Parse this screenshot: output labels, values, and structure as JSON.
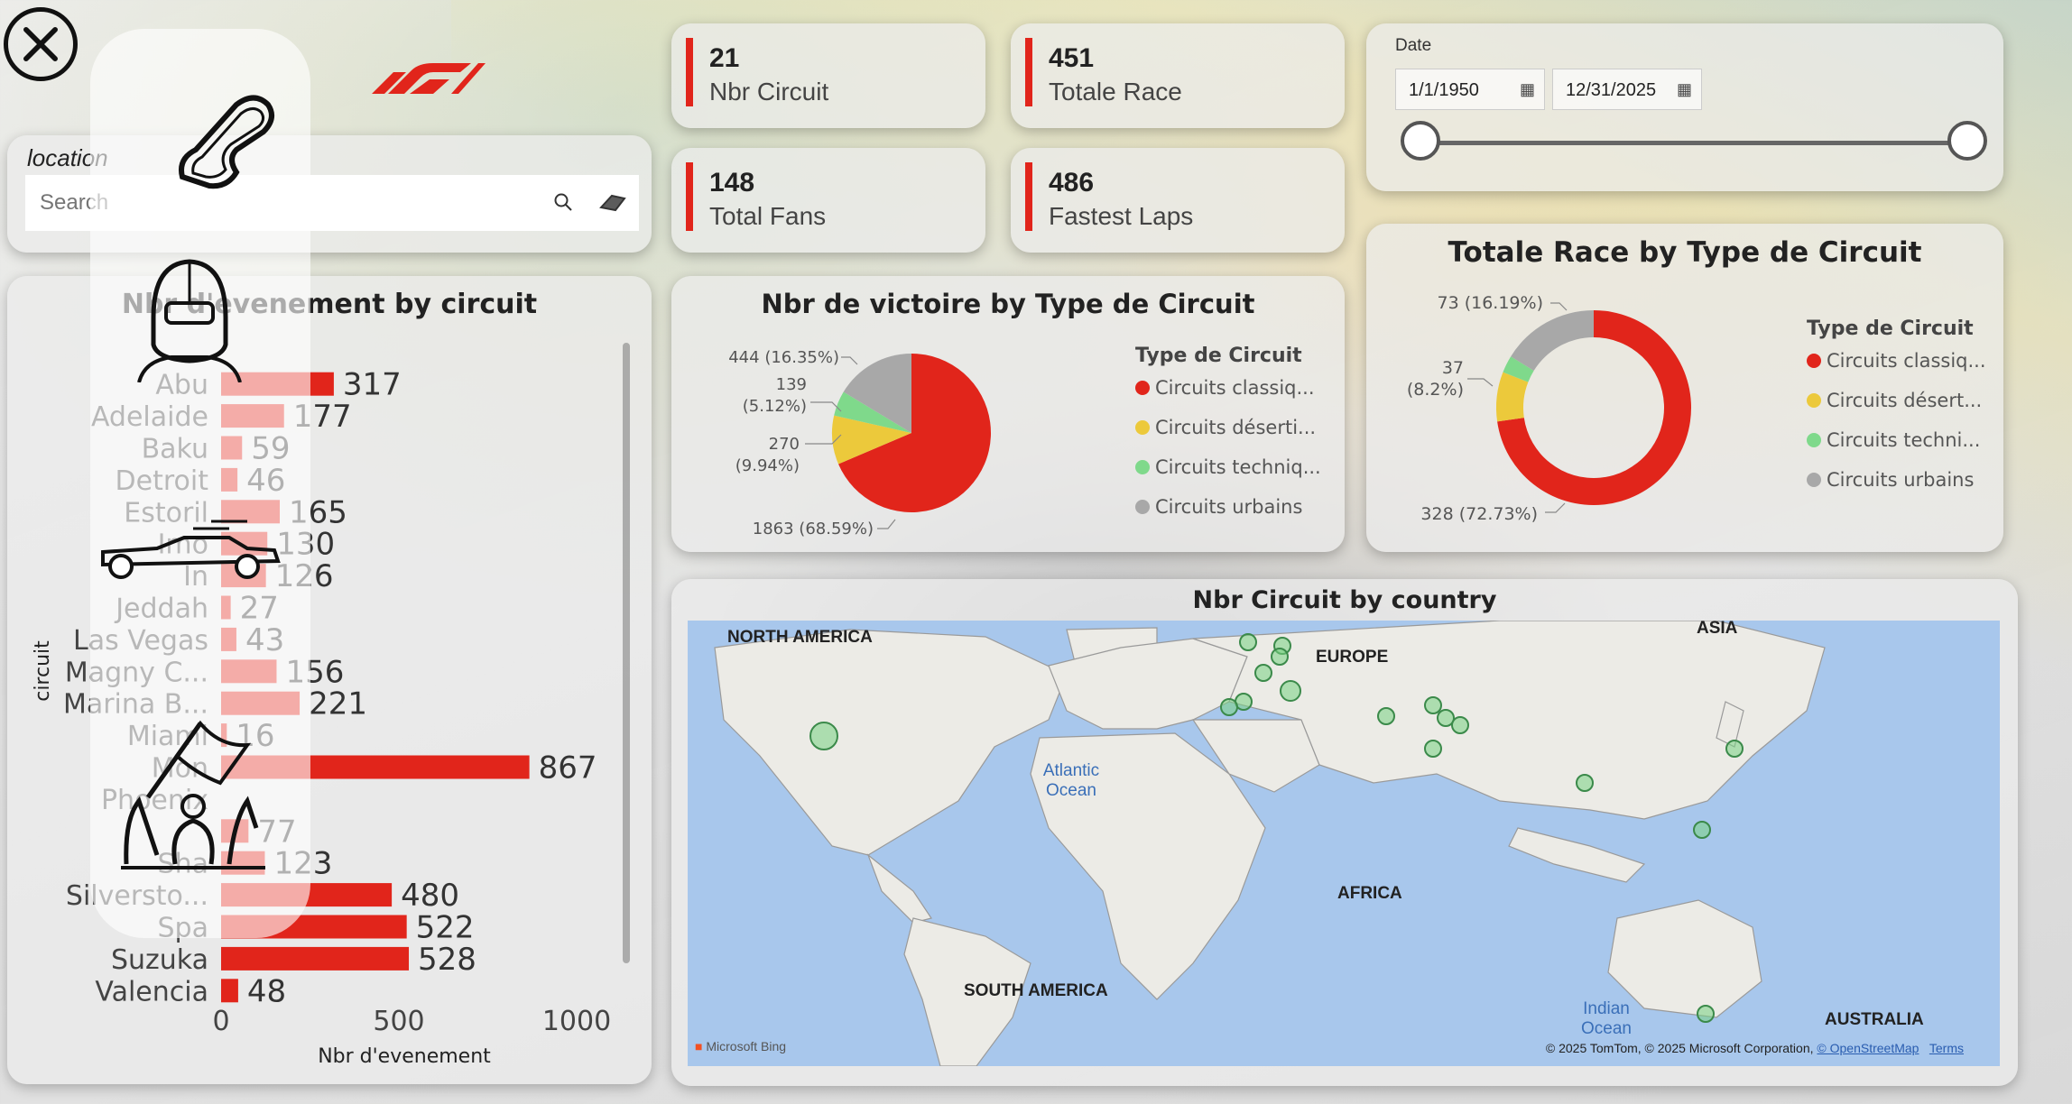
{
  "close_label": "close",
  "kpis": [
    {
      "value": "21",
      "label": "Nbr Circuit"
    },
    {
      "value": "451",
      "label": "Totale Race"
    },
    {
      "value": "148",
      "label": "Total Fans"
    },
    {
      "value": "486",
      "label": "Fastest Laps"
    }
  ],
  "date_slicer": {
    "title": "Date",
    "start": "1/1/1950",
    "end": "12/31/2025",
    "range_fraction": [
      0,
      1
    ]
  },
  "location_search": {
    "title": "location",
    "placeholder": "Search"
  },
  "colors": {
    "accent": "#e1251b",
    "classiques": "#e1251b",
    "desertiques": "#ecc93b",
    "techniques": "#7fd98b",
    "urbains": "#a8a8a8"
  },
  "icon_rail": [
    "race-track-icon",
    "driver-helmet-icon",
    "f1-car-icon",
    "fans-flag-icon"
  ],
  "chart_data": [
    {
      "type": "bar",
      "title": "Nbr d'evenement by circuit",
      "xlabel": "Nbr d'evenement",
      "ylabel": "circuit",
      "xlim": [
        0,
        1000
      ],
      "xticks": [
        "0",
        "500",
        "1000"
      ],
      "categories": [
        "Abu",
        "Adelaide",
        "Baku",
        "Detroit",
        "Estoril",
        "Imo",
        "In",
        "Jeddah",
        "Las Vegas",
        "Magny C...",
        "Marina B...",
        "Miami",
        "Mon",
        "Phoenix",
        "",
        "Sha",
        "Silversto...",
        "Spa",
        "Suzuka",
        "Valencia"
      ],
      "values": [
        317,
        177,
        59,
        46,
        165,
        130,
        126,
        27,
        43,
        156,
        221,
        16,
        867,
        null,
        77,
        123,
        480,
        522,
        528,
        48
      ]
    },
    {
      "type": "pie",
      "title": "Nbr de victoire by Type de Circuit",
      "legend_title": "Type de Circuit",
      "legend": [
        "Circuits classiq...",
        "Circuits déserti...",
        "Circuits techniq...",
        "Circuits urbains"
      ],
      "values": [
        1863,
        270,
        139,
        444
      ],
      "labels": [
        "1863 (68.59%)",
        "270",
        "(9.94%)",
        "139",
        "(5.12%)",
        "444 (16.35%)"
      ]
    },
    {
      "type": "pie",
      "title": "Totale Race by Type de Circuit",
      "legend_title": "Type de Circuit",
      "legend": [
        "Circuits classiq...",
        "Circuits désert...",
        "Circuits techni...",
        "Circuits urbains"
      ],
      "values": [
        328,
        37,
        13,
        73
      ],
      "labels": [
        "328 (72.73%)",
        "37",
        "(8.2%)",
        "73 (16.19%)"
      ]
    }
  ],
  "map": {
    "title": "Nbr Circuit by country",
    "labels": [
      "NORTH AMERICA",
      "EUROPE",
      "ASIA",
      "AFRICA",
      "SOUTH AMERICA",
      "AUSTRALIA"
    ],
    "oceans": [
      "Atlantic\nOcean",
      "Indian\nOcean"
    ],
    "credit": "© 2025 TomTom, © 2025 Microsoft Corporation,",
    "osm_link": "© OpenStreetMap",
    "terms_link": "Terms",
    "bing": "Microsoft Bing"
  }
}
